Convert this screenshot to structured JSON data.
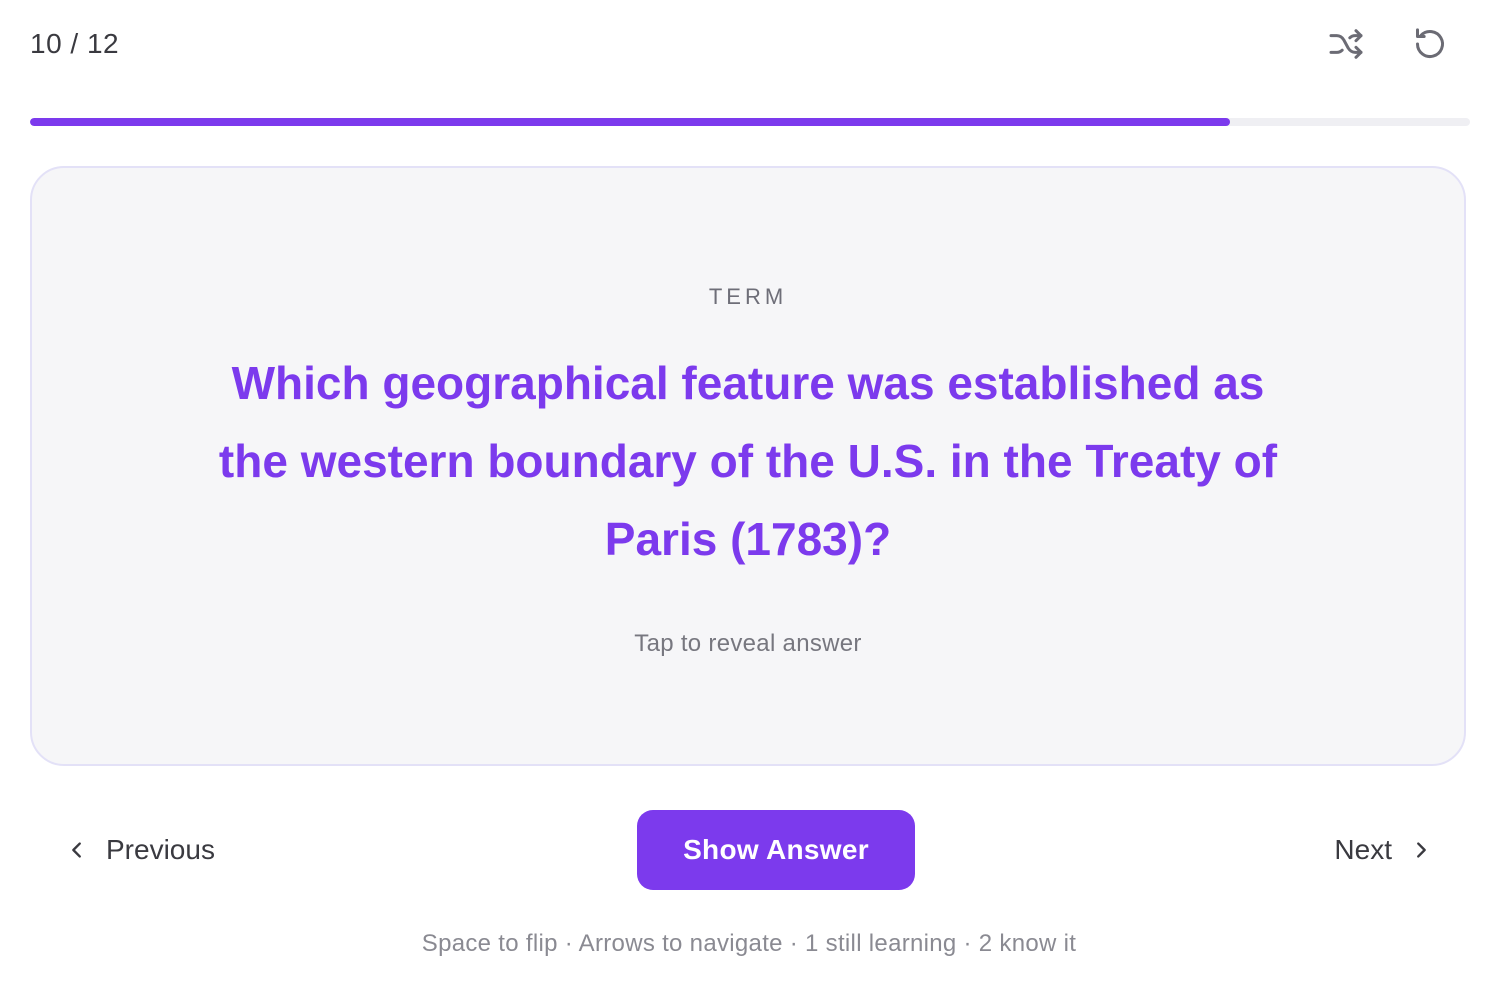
{
  "header": {
    "counter": "10 / 12",
    "shuffle_icon": "shuffle-icon",
    "reset_icon": "reset-icon"
  },
  "progress": {
    "current": 10,
    "total": 12,
    "fraction": 0.8333,
    "color": "#7c3aed",
    "track_color": "#efeff3"
  },
  "card": {
    "label": "TERM",
    "question": "Which geographical feature was established as the western boundary of the U.S. in the Treaty of Paris (1783)?",
    "hint": "Tap to reveal answer",
    "background": "#f6f6f8",
    "border_color": "#e3e1f7",
    "text_color": "#7c3aed"
  },
  "navigation": {
    "previous_label": "Previous",
    "next_label": "Next",
    "show_answer_label": "Show Answer",
    "previous_icon": "chevron-left-icon",
    "next_icon": "chevron-right-icon",
    "accent": "#7c3aed"
  },
  "footer": {
    "hint": "Space to flip · Arrows to navigate · 1 still learning · 2 know it"
  }
}
